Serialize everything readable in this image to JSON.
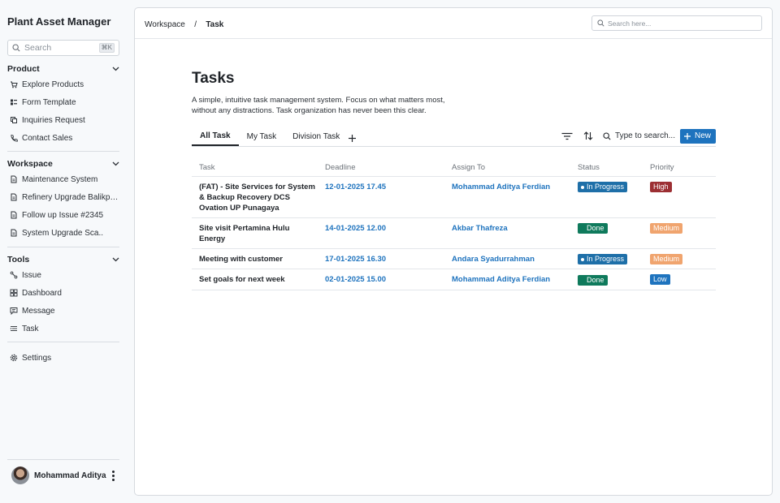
{
  "app": {
    "title": "Plant Asset Manager"
  },
  "sidebar": {
    "search": {
      "placeholder": "Search",
      "shortcut": "⌘K"
    },
    "sections": [
      {
        "title": "Product",
        "items": [
          {
            "label": "Explore Products",
            "icon": "shop-icon"
          },
          {
            "label": "Form Template",
            "icon": "layout-icon"
          },
          {
            "label": "Inquiries Request",
            "icon": "inquiry-icon"
          },
          {
            "label": "Contact Sales",
            "icon": "phone-icon"
          }
        ]
      },
      {
        "title": "Workspace",
        "items": [
          {
            "label": "Maintenance System",
            "icon": "document-icon"
          },
          {
            "label": "Refinery Upgrade Balikpap...",
            "icon": "document-icon"
          },
          {
            "label": "Follow up Issue #2345",
            "icon": "document-icon"
          },
          {
            "label": "System Upgrade Sca..",
            "icon": "document-icon"
          }
        ]
      },
      {
        "title": "Tools",
        "items": [
          {
            "label": "Issue",
            "icon": "issue-icon"
          },
          {
            "label": "Dashboard",
            "icon": "dashboard-icon"
          },
          {
            "label": "Message",
            "icon": "message-icon"
          },
          {
            "label": "Task",
            "icon": "task-icon"
          }
        ]
      }
    ],
    "settings": {
      "label": "Settings",
      "icon": "gear-icon"
    },
    "user": {
      "name": "Mohammad Aditya"
    }
  },
  "header": {
    "breadcrumb": {
      "root": "Workspace",
      "separator": "/",
      "current": "Task"
    },
    "search": {
      "placeholder": "Search here..."
    }
  },
  "page": {
    "title": "Tasks",
    "description": "A simple, intuitive task management system. Focus on what matters most, without any distractions. Task organization has never been this clear.",
    "tabs": [
      {
        "label": "All Task",
        "active": true
      },
      {
        "label": "My Task",
        "active": false
      },
      {
        "label": "Division Task",
        "active": false
      }
    ],
    "toolbar": {
      "search_placeholder": "Type to search...",
      "new_label": "New"
    },
    "table": {
      "columns": [
        "Task",
        "Deadline",
        "Assign To",
        "Status",
        "Priority"
      ],
      "rows": [
        {
          "task": "(FAT) - Site Services for System & Backup Recovery DCS Ovation UP Punagaya",
          "deadline": "12-01-2025 17.45",
          "assignee": "Mohammad Aditya Ferdian",
          "status": "In Progress",
          "priority": "High"
        },
        {
          "task": "Site visit Pertamina Hulu Energy",
          "deadline": "14-01-2025 12.00",
          "assignee": "Akbar Thafreza",
          "status": "Done",
          "priority": "Medium"
        },
        {
          "task": "Meeting with customer",
          "deadline": "17-01-2025 16.30",
          "assignee": "Andara Syadurrahman",
          "status": "In Progress",
          "priority": "Medium"
        },
        {
          "task": "Set goals for next week",
          "deadline": "02-01-2025 15.00",
          "assignee": "Mohammad Aditya Ferdian",
          "status": "Done",
          "priority": "Low"
        }
      ]
    }
  },
  "colors": {
    "accent": "#1e73be",
    "in_progress": "#1e6fa8",
    "done": "#0f7a5c",
    "high": "#9c2f33",
    "medium": "#f0a46e",
    "low": "#1e73be"
  }
}
